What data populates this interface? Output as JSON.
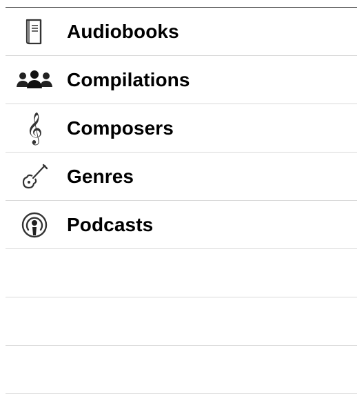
{
  "list": {
    "items": [
      {
        "label": "Audiobooks",
        "icon": "book-icon"
      },
      {
        "label": "Compilations",
        "icon": "people-group-icon"
      },
      {
        "label": "Composers",
        "icon": "treble-clef-icon"
      },
      {
        "label": "Genres",
        "icon": "guitar-icon"
      },
      {
        "label": "Podcasts",
        "icon": "podcast-icon"
      }
    ],
    "empty_rows": 3
  },
  "colors": {
    "text": "#000000",
    "icon": "#333333",
    "separator": "#d9d9d9",
    "top_border": "#222222",
    "background": "#ffffff"
  }
}
